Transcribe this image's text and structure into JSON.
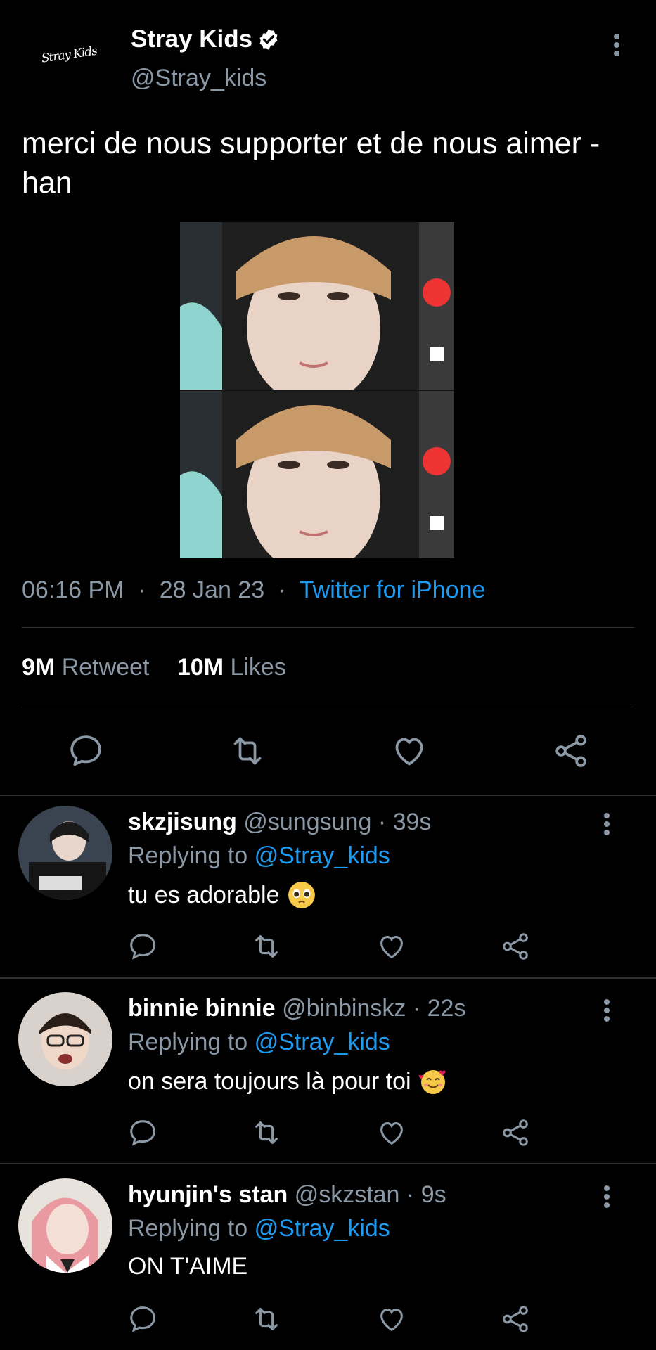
{
  "tweet": {
    "logo_text": "Stray Kids",
    "author_name": "Stray Kids",
    "author_handle": "@Stray_kids",
    "text": "merci de nous supporter et de nous aimer -han",
    "time": "06:16 PM",
    "date": "28 Jan 23",
    "source": "Twitter for iPhone",
    "sep": "·",
    "retweets_count": "9M",
    "retweets_label": "Retweet",
    "likes_count": "10M",
    "likes_label": "Likes"
  },
  "colors": {
    "accent": "#1d9bf0",
    "muted": "#8b98a5",
    "divider": "#2f3336"
  },
  "replies": [
    {
      "name": "skzjisung",
      "handle": "@sungsung",
      "time": "39s",
      "replying_prefix": "Replying to",
      "replying_to": "@Stray_kids",
      "text": "tu es adorable",
      "emoji": "pleading-face-icon"
    },
    {
      "name": "binnie binnie",
      "handle": "@binbinskz",
      "time": "22s",
      "replying_prefix": "Replying to",
      "replying_to": "@Stray_kids",
      "text": "on sera toujours là pour toi",
      "emoji": "smiling-face-with-hearts-icon"
    },
    {
      "name": "hyunjin's stan",
      "handle": "@skzstan",
      "time": "9s",
      "replying_prefix": "Replying to",
      "replying_to": "@Stray_kids",
      "text": "ON T'AIME",
      "emoji": ""
    }
  ]
}
